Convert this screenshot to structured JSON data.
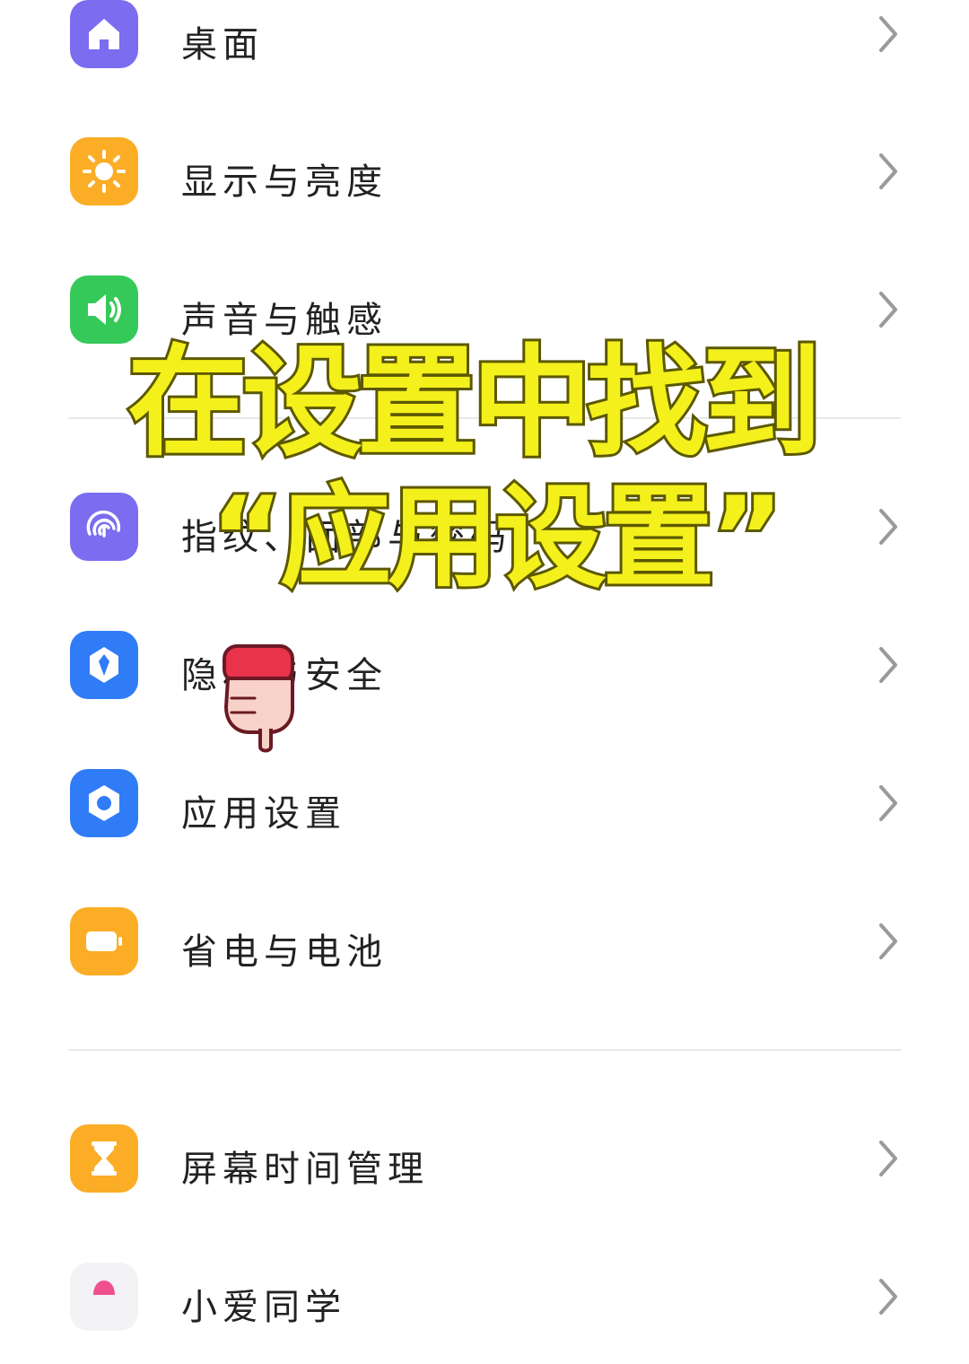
{
  "colors": {
    "purple": "#7b6cf0",
    "orange": "#fbad26",
    "green": "#35c95a",
    "blue": "#2f7cf6",
    "overlay_fill": "#f4f01c",
    "overlay_stroke": "#5c5800"
  },
  "settings": {
    "items": [
      {
        "label": "桌面",
        "icon": "home-icon"
      },
      {
        "label": "显示与亮度",
        "icon": "sun-icon"
      },
      {
        "label": "声音与触感",
        "icon": "speaker-icon"
      },
      {
        "label": "指纹、面部与密码",
        "icon": "fingerprint-icon"
      },
      {
        "label": "隐私与安全",
        "icon": "shield-icon"
      },
      {
        "label": "应用设置",
        "icon": "app-settings-icon"
      },
      {
        "label": "省电与电池",
        "icon": "battery-icon"
      },
      {
        "label": "屏幕时间管理",
        "icon": "hourglass-icon"
      },
      {
        "label": "小爱同学",
        "icon": "assistant-icon"
      }
    ]
  },
  "overlay": {
    "line1": "在设置中找到",
    "line2": "“应用设置”"
  },
  "pointer": {
    "icon": "pointing-hand-icon"
  }
}
